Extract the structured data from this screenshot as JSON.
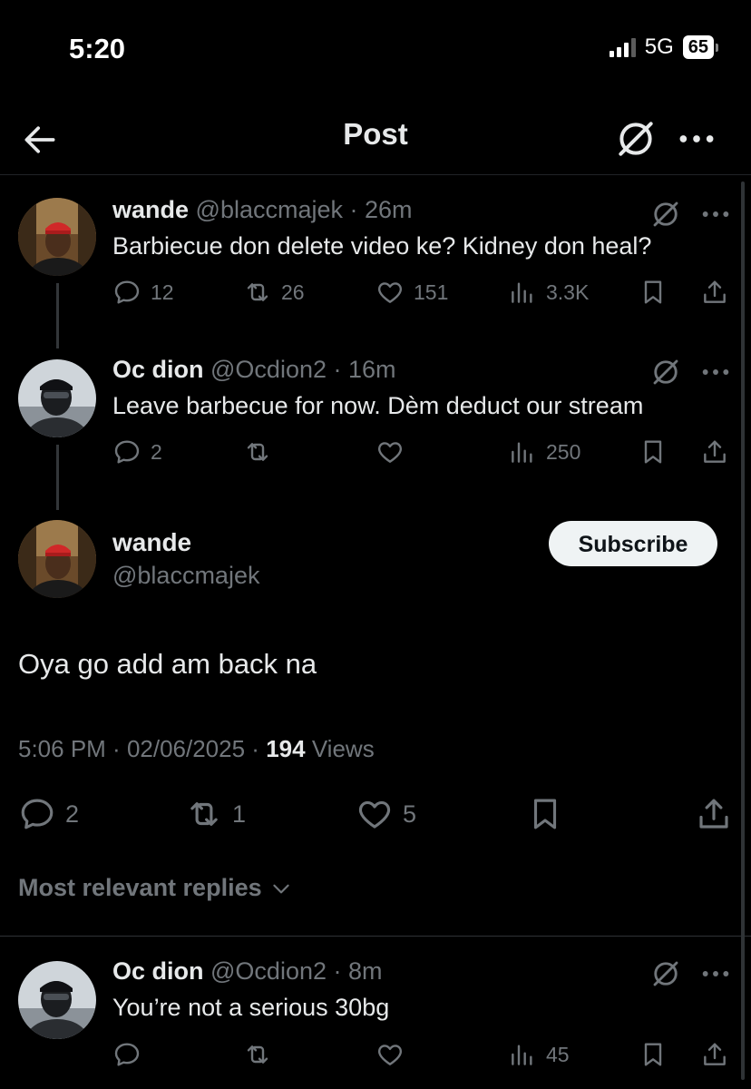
{
  "status_bar": {
    "time": "5:20",
    "network": "5G",
    "battery": "65"
  },
  "header": {
    "title": "Post"
  },
  "thread": [
    {
      "name": "wande",
      "handle": "@blaccmajek",
      "time": "26m",
      "text": "Barbiecue don delete video ke? Kidney don heal?",
      "replies": "12",
      "reposts": "26",
      "likes": "151",
      "views": "3.3K"
    },
    {
      "name": "Oc dion",
      "handle": "@Ocdion2",
      "time": "16m",
      "text": "Leave barbecue for now. Dèm deduct our stream",
      "replies": "2",
      "reposts": "",
      "likes": "",
      "views": "250"
    }
  ],
  "main_post": {
    "name": "wande",
    "handle": "@blaccmajek",
    "subscribe_label": "Subscribe",
    "text": "Oya go add am back na",
    "time": "5:06 PM",
    "date": "02/06/2025",
    "views": "194",
    "views_label": "Views",
    "replies": "2",
    "reposts": "1",
    "likes": "5"
  },
  "replies_filter": {
    "label": "Most relevant replies"
  },
  "reply": {
    "name": "Oc dion",
    "handle": "@Ocdion2",
    "time": "8m",
    "text": "You’re not a serious 30bg",
    "replies": "",
    "reposts": "",
    "likes": "",
    "views": "45"
  },
  "colors": {
    "background": "#000000",
    "text": "#e7e9ea",
    "muted": "#71767b",
    "button": "#eff3f4"
  },
  "icons": [
    "back-arrow-icon",
    "grok-icon",
    "more-icon",
    "reply-icon",
    "repost-icon",
    "like-icon",
    "views-icon",
    "bookmark-icon",
    "share-icon",
    "chevron-down-icon"
  ]
}
